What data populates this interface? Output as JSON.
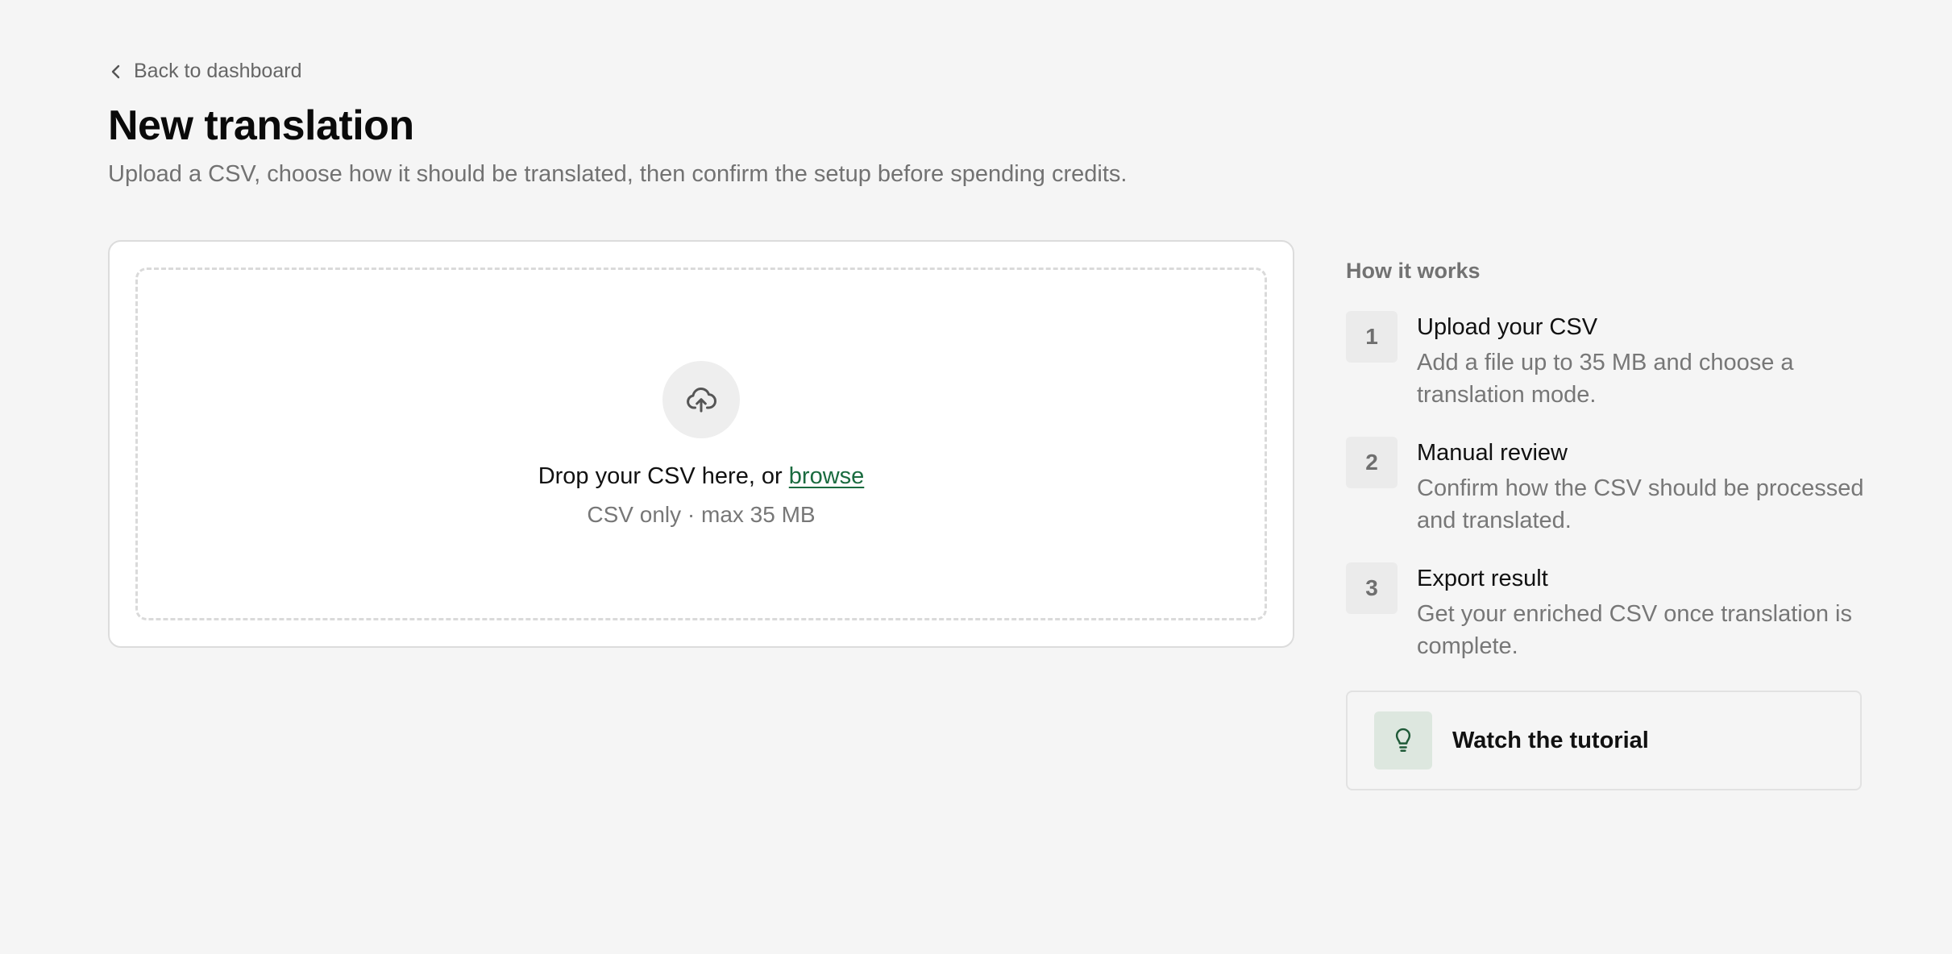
{
  "nav": {
    "back_label": "Back to dashboard"
  },
  "header": {
    "title": "New translation",
    "subtitle": "Upload a CSV, choose how it should be translated, then confirm the setup before spending credits."
  },
  "upload": {
    "icon": "cloud-upload-icon",
    "drop_prefix": "Drop your CSV here, or ",
    "browse_label": "browse",
    "hint": "CSV only · max 35 MB"
  },
  "how_it_works": {
    "heading": "How it works",
    "steps": [
      {
        "number": "1",
        "title": "Upload your CSV",
        "description": "Add a file up to 35 MB and choose a translation mode."
      },
      {
        "number": "2",
        "title": "Manual review",
        "description": "Confirm how the CSV should be processed and translated."
      },
      {
        "number": "3",
        "title": "Export result",
        "description": "Get your enriched CSV once translation is complete."
      }
    ],
    "tutorial": {
      "icon": "lightbulb-icon",
      "label": "Watch the tutorial"
    }
  },
  "colors": {
    "background": "#f5f5f5",
    "accent": "#1a6b3f",
    "tutorial_icon_bg": "#dde7df"
  }
}
